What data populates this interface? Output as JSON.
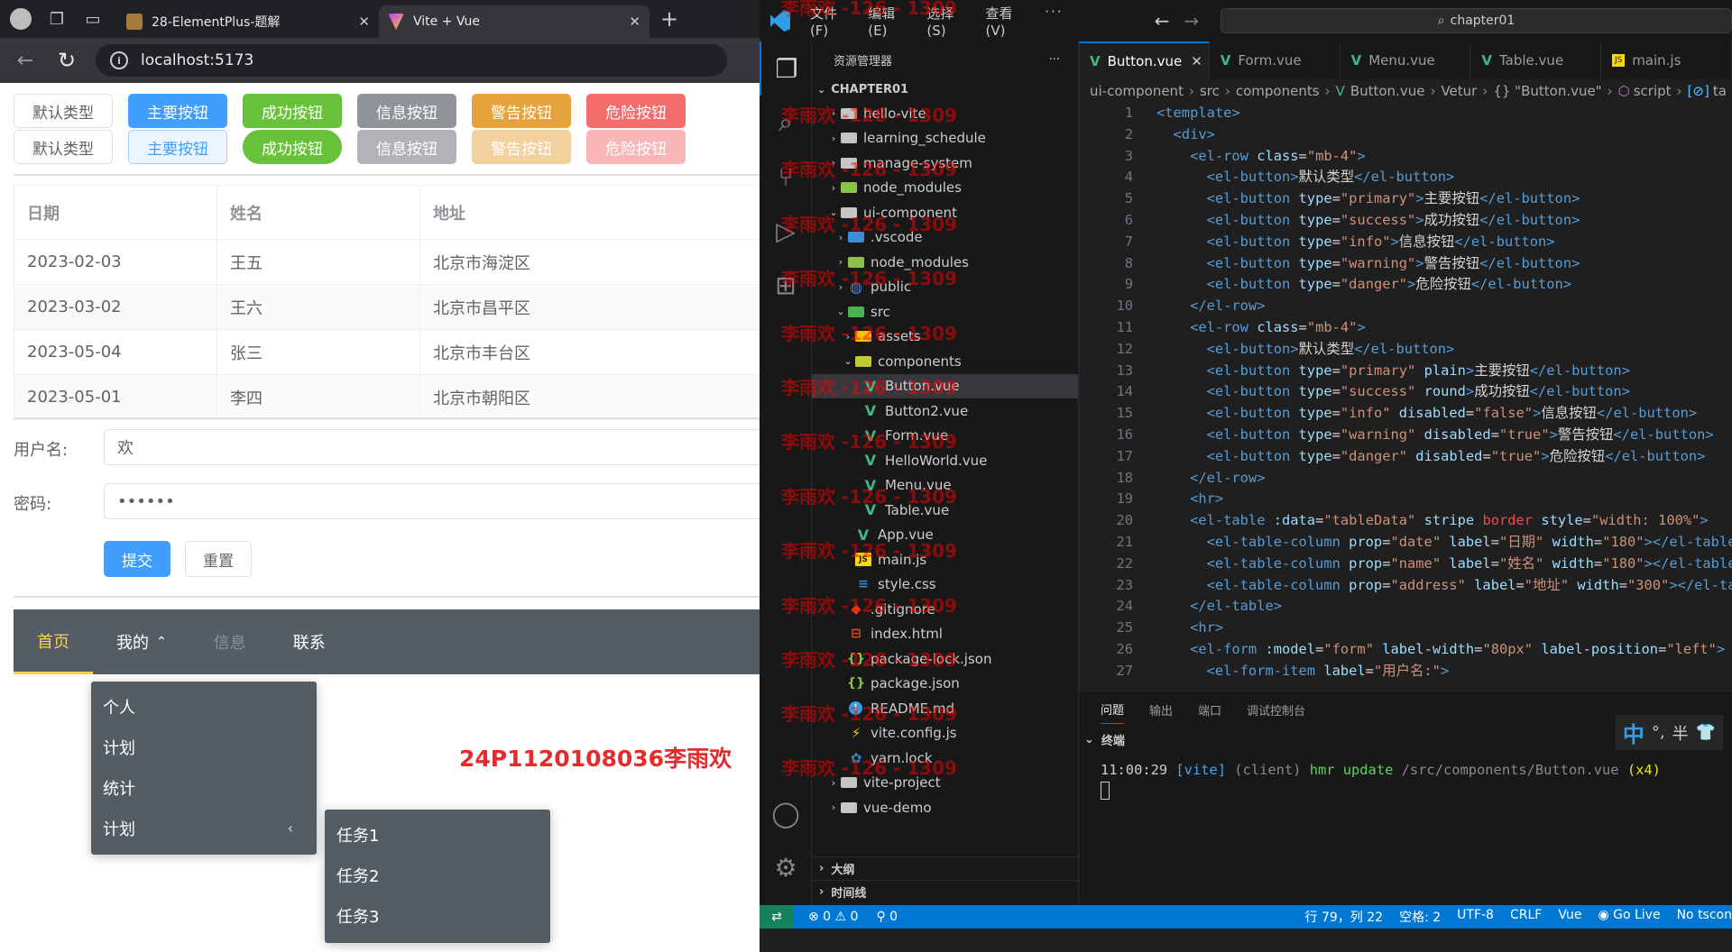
{
  "browser": {
    "tabs": [
      {
        "title": "28-ElementPlus-题解"
      },
      {
        "title": "Vite + Vue"
      }
    ],
    "url": "localhost:5173"
  },
  "app": {
    "buttons_row1": [
      "默认类型",
      "主要按钮",
      "成功按钮",
      "信息按钮",
      "警告按钮",
      "危险按钮"
    ],
    "buttons_row2": [
      "默认类型",
      "主要按钮",
      "成功按钮",
      "信息按钮",
      "警告按钮",
      "危险按钮"
    ],
    "table": {
      "headers": [
        "日期",
        "姓名",
        "地址"
      ],
      "rows": [
        [
          "2023-02-03",
          "王五",
          "北京市海淀区"
        ],
        [
          "2023-03-02",
          "王六",
          "北京市昌平区"
        ],
        [
          "2023-05-04",
          "张三",
          "北京市丰台区"
        ],
        [
          "2023-05-01",
          "李四",
          "北京市朝阳区"
        ]
      ]
    },
    "form": {
      "username_label": "用户名:",
      "username_value": "欢",
      "password_label": "密码:",
      "password_value": "••••••",
      "submit": "提交",
      "reset": "重置"
    },
    "menu": {
      "items": [
        "首页",
        "我的",
        "信息",
        "联系"
      ],
      "caret": "⌃",
      "submenu": [
        "个人",
        "计划",
        "统计",
        "计划"
      ],
      "submenu_arrow": "‹",
      "nested": [
        "任务1",
        "任务2",
        "任务3"
      ]
    },
    "red_text": "24P1120108036李雨欢"
  },
  "vscode": {
    "menus": [
      "文件(F)",
      "编辑(E)",
      "选择(S)",
      "查看(V)",
      "···"
    ],
    "search": "chapter01",
    "explorer_title": "资源管理器",
    "explorer_more": "···",
    "root": "CHAPTER01",
    "tree": [
      {
        "name": "hello-vite",
        "icon": "folder",
        "indent": 1,
        "chev": "›"
      },
      {
        "name": "learning_schedule",
        "icon": "folder",
        "indent": 1,
        "chev": "›"
      },
      {
        "name": "manage-system",
        "icon": "folder",
        "indent": 1,
        "chev": "›"
      },
      {
        "name": "node_modules",
        "icon": "fold-node",
        "indent": 1,
        "chev": "›"
      },
      {
        "name": "ui-component",
        "icon": "folder",
        "indent": 1,
        "chev": "⌄"
      },
      {
        "name": ".vscode",
        "icon": "fold-vscode",
        "indent": 2,
        "chev": "›"
      },
      {
        "name": "node_modules",
        "icon": "fold-node",
        "indent": 2,
        "chev": "›"
      },
      {
        "name": "public",
        "icon": "fold-public",
        "indent": 2,
        "chev": "›"
      },
      {
        "name": "src",
        "icon": "fold-src",
        "indent": 2,
        "chev": "⌄"
      },
      {
        "name": "assets",
        "icon": "fold-assets",
        "indent": 3,
        "chev": "›"
      },
      {
        "name": "components",
        "icon": "fold-comp",
        "indent": 3,
        "chev": "⌄"
      },
      {
        "name": "Button.vue",
        "icon": "vue",
        "indent": 4,
        "chev": "",
        "selected": true
      },
      {
        "name": "Button2.vue",
        "icon": "vue",
        "indent": 4,
        "chev": ""
      },
      {
        "name": "Form.vue",
        "icon": "vue",
        "indent": 4,
        "chev": ""
      },
      {
        "name": "HelloWorld.vue",
        "icon": "vue",
        "indent": 4,
        "chev": ""
      },
      {
        "name": "Menu.vue",
        "icon": "vue",
        "indent": 4,
        "chev": ""
      },
      {
        "name": "Table.vue",
        "icon": "vue",
        "indent": 4,
        "chev": ""
      },
      {
        "name": "App.vue",
        "icon": "vue",
        "indent": 3,
        "chev": ""
      },
      {
        "name": "main.js",
        "icon": "js",
        "indent": 3,
        "chev": ""
      },
      {
        "name": "style.css",
        "icon": "css",
        "indent": 3,
        "chev": ""
      },
      {
        "name": ".gitignore",
        "icon": "git",
        "indent": 2,
        "chev": ""
      },
      {
        "name": "index.html",
        "icon": "html",
        "indent": 2,
        "chev": ""
      },
      {
        "name": "package-lock.json",
        "icon": "json",
        "indent": 2,
        "chev": ""
      },
      {
        "name": "package.json",
        "icon": "json",
        "indent": 2,
        "chev": ""
      },
      {
        "name": "README.md",
        "icon": "info",
        "indent": 2,
        "chev": ""
      },
      {
        "name": "vite.config.js",
        "icon": "vite",
        "indent": 2,
        "chev": ""
      },
      {
        "name": "yarn.lock",
        "icon": "yarn",
        "indent": 2,
        "chev": ""
      },
      {
        "name": "vite-project",
        "icon": "folder",
        "indent": 1,
        "chev": "›"
      },
      {
        "name": "vue-demo",
        "icon": "folder",
        "indent": 1,
        "chev": "›"
      }
    ],
    "outline": "大纲",
    "timeline": "时间线",
    "tabs": [
      {
        "label": "Button.vue",
        "icon": "vue"
      },
      {
        "label": "Form.vue",
        "icon": "vue"
      },
      {
        "label": "Menu.vue",
        "icon": "vue"
      },
      {
        "label": "Table.vue",
        "icon": "vue"
      },
      {
        "label": "main.js",
        "icon": "js"
      }
    ],
    "breadcrumbs": [
      "ui-component",
      "src",
      "components",
      "Button.vue",
      "Vetur",
      "{} \"Button.vue\"",
      "script",
      "ta"
    ],
    "code": [
      [
        [
          "tg",
          "<template>"
        ]
      ],
      [
        [
          "tg",
          "  <div>"
        ]
      ],
      [
        [
          "tg",
          "    <el-row "
        ],
        [
          "at",
          "class"
        ],
        [
          "tx",
          "="
        ],
        [
          "st",
          "\"mb-4\""
        ],
        [
          "tg",
          ">"
        ]
      ],
      [
        [
          "tg",
          "      <el-button>"
        ],
        [
          "tx",
          "默认类型"
        ],
        [
          "tg",
          "</el-button>"
        ]
      ],
      [
        [
          "tg",
          "      <el-button "
        ],
        [
          "at",
          "type"
        ],
        [
          "tx",
          "="
        ],
        [
          "st",
          "\"primary\""
        ],
        [
          "tg",
          ">"
        ],
        [
          "tx",
          "主要按钮"
        ],
        [
          "tg",
          "</el-button>"
        ]
      ],
      [
        [
          "tg",
          "      <el-button "
        ],
        [
          "at",
          "type"
        ],
        [
          "tx",
          "="
        ],
        [
          "st",
          "\"success\""
        ],
        [
          "tg",
          ">"
        ],
        [
          "tx",
          "成功按钮"
        ],
        [
          "tg",
          "</el-button>"
        ]
      ],
      [
        [
          "tg",
          "      <el-button "
        ],
        [
          "at",
          "type"
        ],
        [
          "tx",
          "="
        ],
        [
          "st",
          "\"info\""
        ],
        [
          "tg",
          ">"
        ],
        [
          "tx",
          "信息按钮"
        ],
        [
          "tg",
          "</el-button>"
        ]
      ],
      [
        [
          "tg",
          "      <el-button "
        ],
        [
          "at",
          "type"
        ],
        [
          "tx",
          "="
        ],
        [
          "st",
          "\"warning\""
        ],
        [
          "tg",
          ">"
        ],
        [
          "tx",
          "警告按钮"
        ],
        [
          "tg",
          "</el-button>"
        ]
      ],
      [
        [
          "tg",
          "      <el-button "
        ],
        [
          "at",
          "type"
        ],
        [
          "tx",
          "="
        ],
        [
          "st",
          "\"danger\""
        ],
        [
          "tg",
          ">"
        ],
        [
          "tx",
          "危险按钮"
        ],
        [
          "tg",
          "</el-button>"
        ]
      ],
      [
        [
          "tg",
          "    </el-row>"
        ]
      ],
      [
        [
          "tg",
          "    <el-row "
        ],
        [
          "at",
          "class"
        ],
        [
          "tx",
          "="
        ],
        [
          "st",
          "\"mb-4\""
        ],
        [
          "tg",
          ">"
        ]
      ],
      [
        [
          "tg",
          "      <el-button>"
        ],
        [
          "tx",
          "默认类型"
        ],
        [
          "tg",
          "</el-button>"
        ]
      ],
      [
        [
          "tg",
          "      <el-button "
        ],
        [
          "at",
          "type"
        ],
        [
          "tx",
          "="
        ],
        [
          "st",
          "\"primary\""
        ],
        [
          "at",
          " plain"
        ],
        [
          "tg",
          ">"
        ],
        [
          "tx",
          "主要按钮"
        ],
        [
          "tg",
          "</el-button>"
        ]
      ],
      [
        [
          "tg",
          "      <el-button "
        ],
        [
          "at",
          "type"
        ],
        [
          "tx",
          "="
        ],
        [
          "st",
          "\"success\""
        ],
        [
          "at",
          " round"
        ],
        [
          "tg",
          ">"
        ],
        [
          "tx",
          "成功按钮"
        ],
        [
          "tg",
          "</el-button>"
        ]
      ],
      [
        [
          "tg",
          "      <el-button "
        ],
        [
          "at",
          "type"
        ],
        [
          "tx",
          "="
        ],
        [
          "st",
          "\"info\""
        ],
        [
          "at",
          " disabled"
        ],
        [
          "tx",
          "="
        ],
        [
          "st",
          "\"false\""
        ],
        [
          "tg",
          ">"
        ],
        [
          "tx",
          "信息按钮"
        ],
        [
          "tg",
          "</el-button>"
        ]
      ],
      [
        [
          "tg",
          "      <el-button "
        ],
        [
          "at",
          "type"
        ],
        [
          "tx",
          "="
        ],
        [
          "st",
          "\"warning\""
        ],
        [
          "at",
          " disabled"
        ],
        [
          "tx",
          "="
        ],
        [
          "st",
          "\"true\""
        ],
        [
          "tg",
          ">"
        ],
        [
          "tx",
          "警告按钮"
        ],
        [
          "tg",
          "</el-button>"
        ]
      ],
      [
        [
          "tg",
          "      <el-button "
        ],
        [
          "at",
          "type"
        ],
        [
          "tx",
          "="
        ],
        [
          "st",
          "\"danger\""
        ],
        [
          "at",
          " disabled"
        ],
        [
          "tx",
          "="
        ],
        [
          "st",
          "\"true\""
        ],
        [
          "tg",
          ">"
        ],
        [
          "tx",
          "危险按钮"
        ],
        [
          "tg",
          "</el-button>"
        ]
      ],
      [
        [
          "tg",
          "    </el-row>"
        ]
      ],
      [
        [
          "tg",
          "    <hr>"
        ]
      ],
      [
        [
          "tg",
          "    <el-table "
        ],
        [
          "at",
          ":data"
        ],
        [
          "tx",
          "="
        ],
        [
          "st",
          "\"tableData\""
        ],
        [
          "at",
          " stripe"
        ],
        [
          "dr",
          " border"
        ],
        [
          "at",
          " style"
        ],
        [
          "tx",
          "="
        ],
        [
          "st",
          "\"width: 100%\""
        ],
        [
          "tg",
          ">"
        ]
      ],
      [
        [
          "tg",
          "      <el-table-column "
        ],
        [
          "at",
          "prop"
        ],
        [
          "tx",
          "="
        ],
        [
          "st",
          "\"date\""
        ],
        [
          "at",
          " label"
        ],
        [
          "tx",
          "="
        ],
        [
          "st",
          "\"日期\""
        ],
        [
          "at",
          " width"
        ],
        [
          "tx",
          "="
        ],
        [
          "st",
          "\"180\""
        ],
        [
          "tg",
          "></el-table-column>"
        ]
      ],
      [
        [
          "tg",
          "      <el-table-column "
        ],
        [
          "at",
          "prop"
        ],
        [
          "tx",
          "="
        ],
        [
          "st",
          "\"name\""
        ],
        [
          "at",
          " label"
        ],
        [
          "tx",
          "="
        ],
        [
          "st",
          "\"姓名\""
        ],
        [
          "at",
          " width"
        ],
        [
          "tx",
          "="
        ],
        [
          "st",
          "\"180\""
        ],
        [
          "tg",
          "></el-table-column>"
        ]
      ],
      [
        [
          "tg",
          "      <el-table-column "
        ],
        [
          "at",
          "prop"
        ],
        [
          "tx",
          "="
        ],
        [
          "st",
          "\"address\""
        ],
        [
          "at",
          " label"
        ],
        [
          "tx",
          "="
        ],
        [
          "st",
          "\"地址\""
        ],
        [
          "at",
          " width"
        ],
        [
          "tx",
          "="
        ],
        [
          "st",
          "\"300\""
        ],
        [
          "tg",
          "></el-table-column>"
        ]
      ],
      [
        [
          "tg",
          "    </el-table>"
        ]
      ],
      [
        [
          "tg",
          "    <hr>"
        ]
      ],
      [
        [
          "tg",
          "    <el-form "
        ],
        [
          "at",
          ":model"
        ],
        [
          "tx",
          "="
        ],
        [
          "st",
          "\"form\""
        ],
        [
          "at",
          " label-width"
        ],
        [
          "tx",
          "="
        ],
        [
          "st",
          "\"80px\""
        ],
        [
          "at",
          " label-position"
        ],
        [
          "tx",
          "="
        ],
        [
          "st",
          "\"left\""
        ],
        [
          "tg",
          ">"
        ]
      ],
      [
        [
          "tg",
          "      <el-form-item "
        ],
        [
          "at",
          "label"
        ],
        [
          "tx",
          "="
        ],
        [
          "st",
          "\"用户名:\""
        ],
        [
          "tg",
          ">"
        ]
      ]
    ],
    "panel_tabs": [
      "问题",
      "输出",
      "端口",
      "调试控制台"
    ],
    "terminal_title": "终端",
    "terminal_line": {
      "time": "11:00:29 ",
      "tag": "[vite]",
      "client": " (client) ",
      "hmr": "hmr update ",
      "path": "/src/components/Button.vue ",
      "count": "(x4)"
    },
    "ime": [
      "中",
      "°,",
      "半"
    ],
    "status": {
      "errors": "⊗ 0 ⚠ 0",
      "ports": "⚲ 0",
      "position": "行 79，列 22",
      "spaces": "空格: 2",
      "encoding": "UTF-8",
      "eol": "CRLF",
      "language": "Vue",
      "golive": "Go Live",
      "tscon": "No tscon"
    }
  },
  "watermark": "李雨欢 -126 - 1309",
  "colors": {
    "primary": "#409eff",
    "success": "#67c23a",
    "info": "#909399",
    "warning": "#e6a23c",
    "danger": "#f56c6c",
    "menu_bg": "#545c64",
    "menu_active": "#ffd04b",
    "vscode_status": "#0078d4"
  }
}
